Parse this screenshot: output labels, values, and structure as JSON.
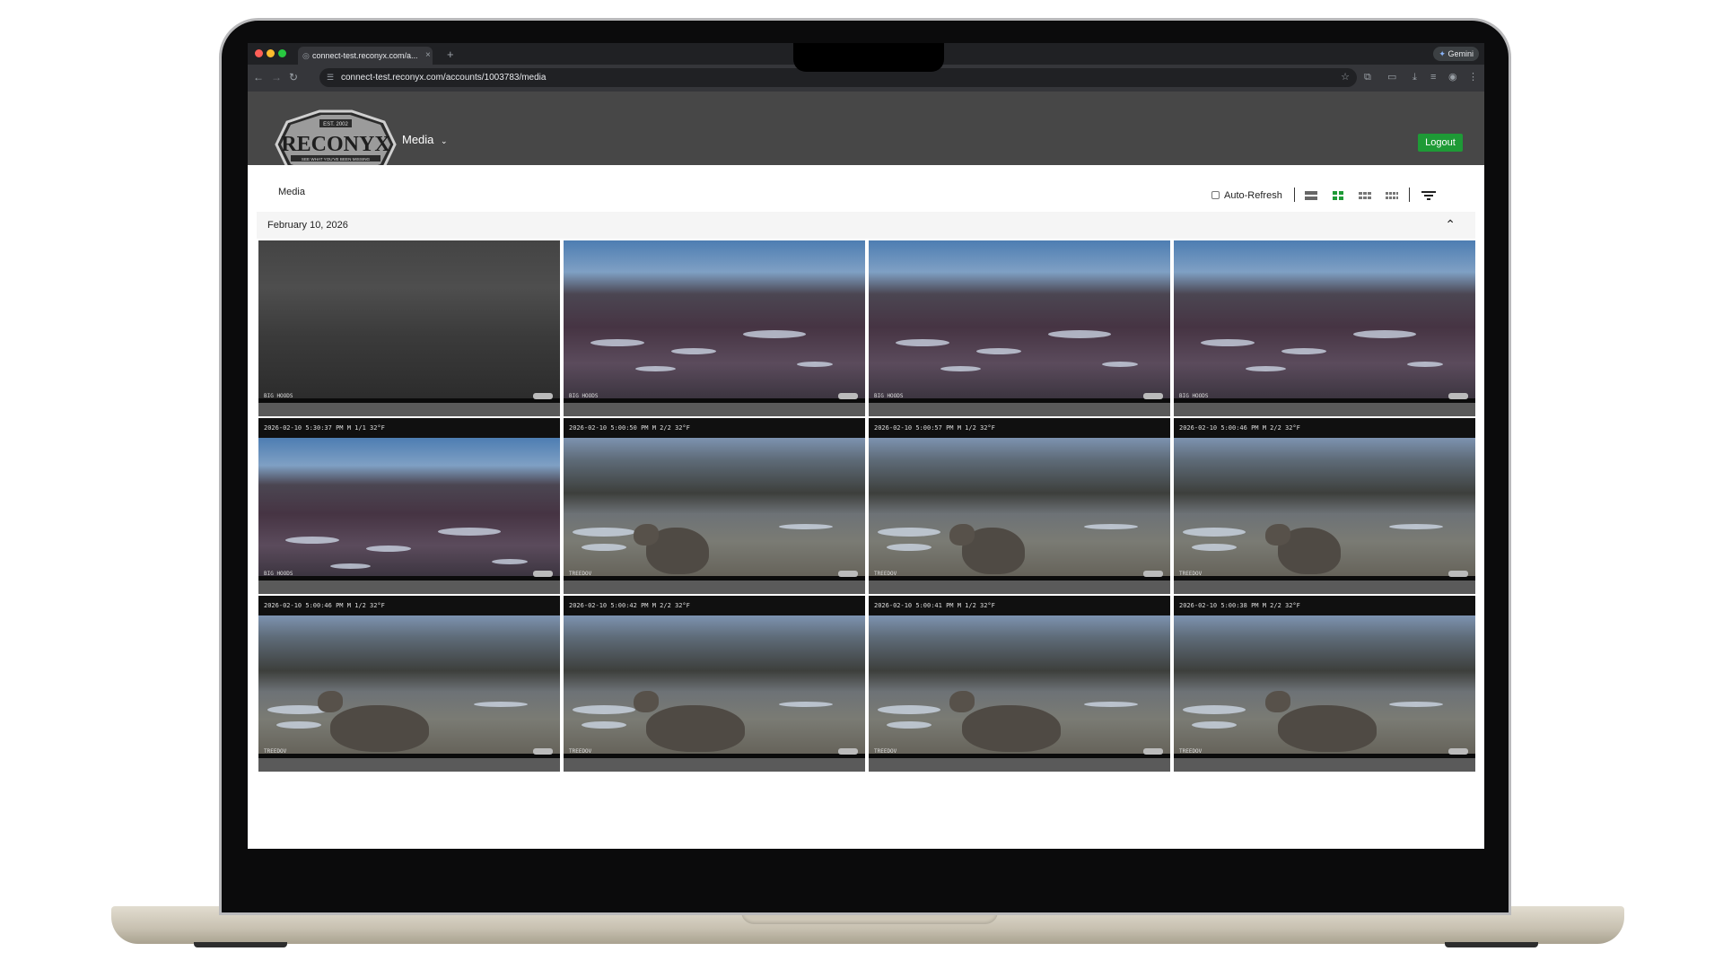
{
  "browser": {
    "tab_title": "connect-test.reconyx.com/a...",
    "tab_close": "×",
    "new_tab": "+",
    "gemini_label": "Gemini",
    "url": "connect-test.reconyx.com/accounts/1003783/media"
  },
  "header": {
    "logo_est": "EST. 2002",
    "logo_text": "RECONYX",
    "logo_tagline": "SEE WHAT YOU'VE BEEN MISSING",
    "menu_label": "Media",
    "logout_label": "Logout"
  },
  "page": {
    "breadcrumb": "Media",
    "auto_refresh_label": "Auto-Refresh",
    "auto_refresh_checked": false,
    "active_view": "grid-medium",
    "date_group": "February 10, 2026",
    "accent_color": "#1e9a36"
  },
  "tiles": [
    {
      "stamp": "",
      "camera": "BIG HOODS",
      "scene": "night"
    },
    {
      "stamp": "",
      "camera": "BIG HOODS",
      "scene": "field"
    },
    {
      "stamp": "",
      "camera": "BIG HOODS",
      "scene": "field"
    },
    {
      "stamp": "",
      "camera": "BIG HOODS",
      "scene": "field"
    },
    {
      "stamp": "2026-02-10  5:30:37 PM  M 1/1          32°F",
      "camera": "BIG HOODS",
      "scene": "field"
    },
    {
      "stamp": "2026-02-10  5:00:50 PM  M 2/2          32°F",
      "camera": "TREEDOV",
      "scene": "woods"
    },
    {
      "stamp": "2026-02-10  5:00:57 PM  M 1/2          32°F",
      "camera": "TREEDOV",
      "scene": "woods"
    },
    {
      "stamp": "2026-02-10  5:00:46 PM  M 2/2          32°F",
      "camera": "TREEDOV",
      "scene": "woods"
    },
    {
      "stamp": "2026-02-10  5:00:46 PM  M 1/2          32°F",
      "camera": "TREEDOV",
      "scene": "woods"
    },
    {
      "stamp": "2026-02-10  5:00:42 PM  M 2/2          32°F",
      "camera": "TREEDOV",
      "scene": "woods"
    },
    {
      "stamp": "2026-02-10  5:00:41 PM  M 1/2          32°F",
      "camera": "TREEDOV",
      "scene": "woods"
    },
    {
      "stamp": "2026-02-10  5:00:38 PM  M 2/2          32°F",
      "camera": "TREEDOV",
      "scene": "woods"
    }
  ]
}
